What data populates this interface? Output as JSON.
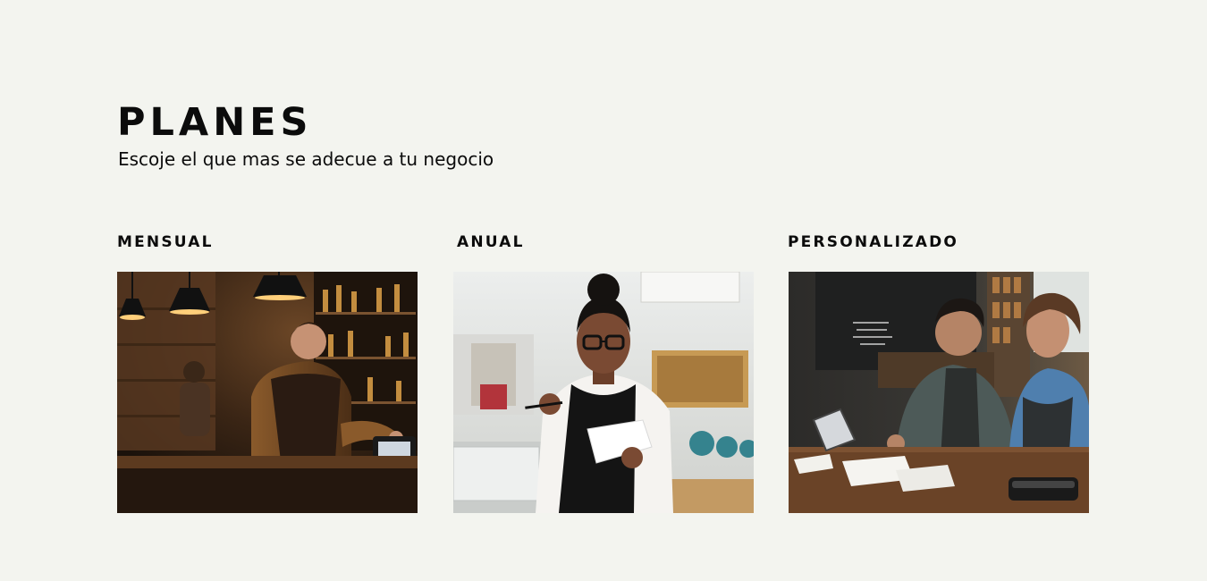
{
  "section": {
    "title": "PLANES",
    "subtitle": "Escoje el que mas se adecue a tu negocio"
  },
  "plans": [
    {
      "name": "MENSUAL",
      "image": "bartender-using-point-of-sale-terminal-photo",
      "colors": {
        "background": "#2a1b10",
        "accent": "#d99a3e"
      }
    },
    {
      "name": "ANUAL",
      "image": "waitress-writing-order-on-notepad-photo",
      "colors": {
        "background": "#dfe0dc",
        "accent": "#161616"
      }
    },
    {
      "name": "PERSONALIZADO",
      "image": "business-owners-reviewing-receipts-photo",
      "colors": {
        "background": "#3c3a36",
        "accent": "#4f7fae"
      }
    }
  ],
  "theme": {
    "background": "#f3f4ef",
    "text": "#0b0b0b"
  }
}
